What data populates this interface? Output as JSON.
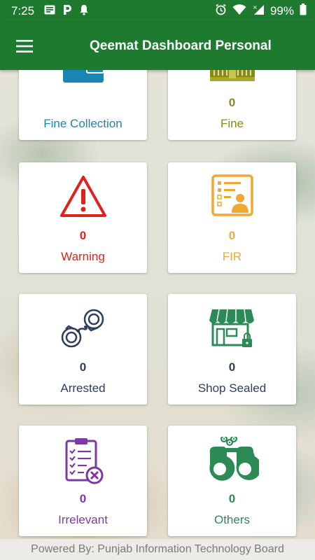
{
  "status_bar": {
    "time": "7:25",
    "battery": "99%",
    "notification_icons": [
      "news-icon",
      "p-icon",
      "bell-icon"
    ],
    "system_icons": [
      "alarm-icon",
      "wifi-icon",
      "signal-icon",
      "battery-icon"
    ]
  },
  "app_bar": {
    "title": "Qeemat Dashboard Personal",
    "menu_icon": "hamburger-menu-icon"
  },
  "cards": [
    {
      "label": "Fine Collection",
      "count": "",
      "icon": "wallet-icon",
      "color": "#1a86b4"
    },
    {
      "label": "Fine",
      "count": "0",
      "icon": "money-stack-icon",
      "color": "#8a8a10"
    },
    {
      "label": "Warning",
      "count": "0",
      "icon": "warning-triangle-icon",
      "color": "#e0221c"
    },
    {
      "label": "FIR",
      "count": "0",
      "icon": "report-document-icon",
      "color": "#f0a830"
    },
    {
      "label": "Arrested",
      "count": "0",
      "icon": "handcuffs-icon",
      "color": "#2f3d5c"
    },
    {
      "label": "Shop Sealed",
      "count": "0",
      "icon": "shop-locked-icon",
      "color": "#2b8a55"
    },
    {
      "label": "Irrelevant",
      "count": "0",
      "icon": "clipboard-x-icon",
      "color": "#7b3aa3"
    },
    {
      "label": "Others",
      "count": "0",
      "icon": "handcuffs-filled-icon",
      "color": "#2b8a55"
    }
  ],
  "footer": {
    "text": "Powered By: Punjab Information Technology Board"
  }
}
